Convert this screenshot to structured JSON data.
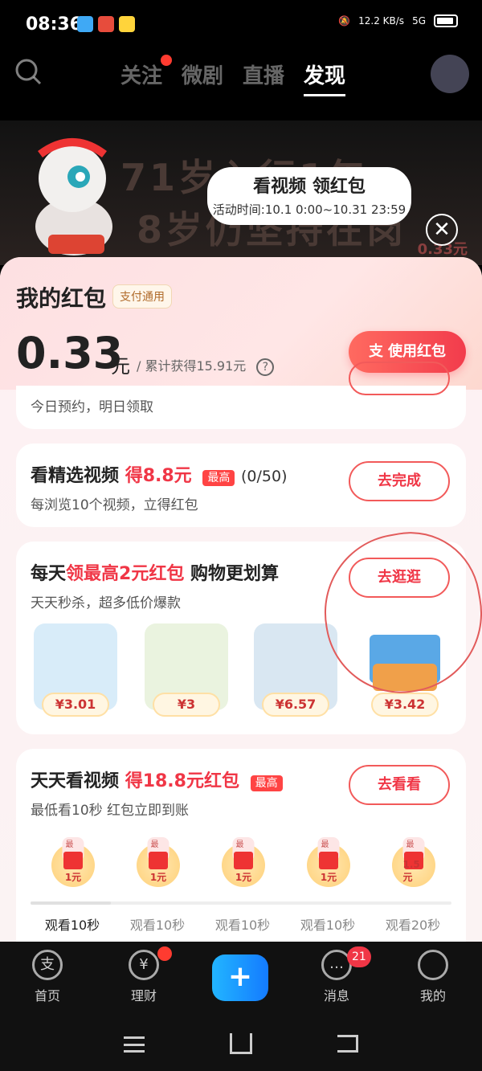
{
  "status": {
    "time": "08:36",
    "net_speed": "12.2 KB/s",
    "network": "5G",
    "battery": ""
  },
  "topnav": {
    "tabs": [
      "关注",
      "微剧",
      "直播",
      "发现"
    ],
    "active": "发现"
  },
  "banner": {
    "big_text_1": "71岁入行1年",
    "big_text_2": "8岁仍坚持在岗",
    "bubble_title": "看视频 领红包",
    "bubble_time": "活动时间:10.1 0:00~10.31 23:59",
    "side_amount": "0.33元"
  },
  "sheet": {
    "title": "我的红包",
    "badge": "支付通用",
    "amount": "0.33",
    "unit": "元",
    "total_text": "/ 累计获得15.91元",
    "use_button": "使用红包"
  },
  "cards": {
    "c0": {
      "desc": "今日预约，明日领取"
    },
    "c1": {
      "title_a": "看精选视频",
      "title_b": "得8.8元",
      "tag": "最高",
      "progress": "(0/50)",
      "desc": "每浏览10个视频，立得红包",
      "button": "去完成"
    },
    "c2": {
      "title_a": "每天",
      "title_b": "领最高2元红包",
      "title_c": "购物更划算",
      "desc": "天天秒杀，超多低价爆款",
      "button": "去逛逛",
      "products": [
        {
          "price": "¥3.01"
        },
        {
          "price": "¥3"
        },
        {
          "price": "¥6.57"
        },
        {
          "price": "¥3.42"
        }
      ]
    },
    "c3": {
      "title_a": "天天看视频",
      "title_b": "得18.8元红包",
      "tag": "最高",
      "desc": "最低看10秒 红包立即到账",
      "button": "去看看",
      "coins": [
        {
          "label": "最高",
          "amount": "1元",
          "watch": "观看10秒"
        },
        {
          "label": "最高",
          "amount": "1元",
          "watch": "观看10秒"
        },
        {
          "label": "最高",
          "amount": "1元",
          "watch": "观看10秒"
        },
        {
          "label": "最高",
          "amount": "1元",
          "watch": "观看10秒"
        },
        {
          "label": "最高",
          "amount": "1.5元",
          "watch": "观看20秒"
        }
      ]
    }
  },
  "bottomnav": {
    "items": [
      "首页",
      "理财",
      "",
      "消息",
      "我的"
    ],
    "message_badge": "21"
  },
  "colors": {
    "accent": "#f03646",
    "button_gradient_start": "#ff6a60",
    "button_gradient_end": "#f23c4c",
    "plus_button": "#1a8cff"
  }
}
